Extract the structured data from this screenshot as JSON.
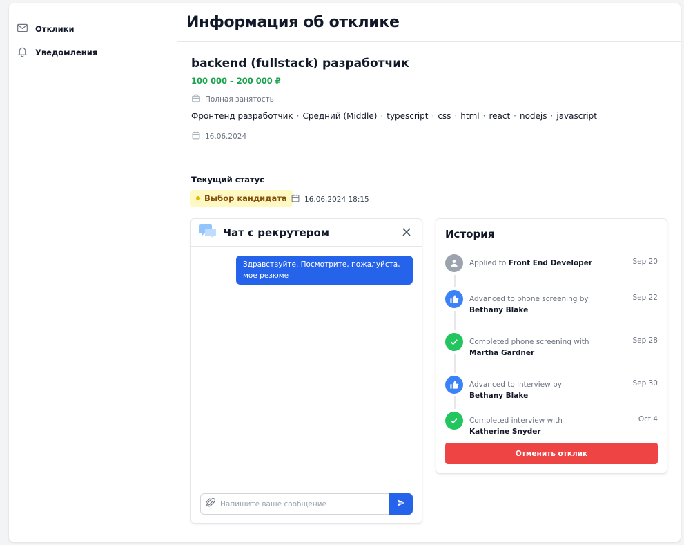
{
  "sidebar": {
    "items": [
      {
        "label": "Отклики",
        "icon": "mail-icon"
      },
      {
        "label": "Уведомления",
        "icon": "bell-icon"
      }
    ]
  },
  "header": {
    "title": "Информация об отклике"
  },
  "vacancy": {
    "title": "backend (fullstack) разработчик",
    "salary": "100 000 – 200 000 ₽",
    "employment": "Полная занятость",
    "tags": [
      "Фронтенд разработчик",
      "Средний (Middle)",
      "typescript",
      "css",
      "html",
      "react",
      "nodejs",
      "javascript"
    ],
    "date": "16.06.2024"
  },
  "status": {
    "label": "Текущий статус",
    "value": "Выбор кандидата",
    "date": "16.06.2024 18:15",
    "color": "#eab308"
  },
  "chat": {
    "title": "Чат с рекрутером",
    "messages": [
      {
        "text": "Здравствуйте. Посмотрите, пожалуйста, мое резюме"
      }
    ],
    "input_placeholder": "Напишите ваше сообщение"
  },
  "history": {
    "title": "История",
    "events": [
      {
        "prefix": "Applied to ",
        "name": "Front End Developer",
        "date": "Sep 20",
        "icon": "user-icon",
        "color": "#9ca3af"
      },
      {
        "prefix": "Advanced to phone screening by ",
        "name": "Bethany Blake",
        "date": "Sep 22",
        "icon": "thumbs-up-icon",
        "color": "#3b82f6"
      },
      {
        "prefix": "Completed phone screening with ",
        "name": "Martha Gardner",
        "date": "Sep 28",
        "icon": "check-icon",
        "color": "#22c55e"
      },
      {
        "prefix": "Advanced to interview by ",
        "name": "Bethany Blake",
        "date": "Sep 30",
        "icon": "thumbs-up-icon",
        "color": "#3b82f6"
      },
      {
        "prefix": "Completed interview with ",
        "name": "Katherine Snyder",
        "date": "Oct 4",
        "icon": "check-icon",
        "color": "#22c55e"
      }
    ],
    "cancel_label": "Отменить отклик"
  },
  "colors": {
    "accent": "#2563eb",
    "success": "#16a34a",
    "danger": "#ef4444"
  }
}
